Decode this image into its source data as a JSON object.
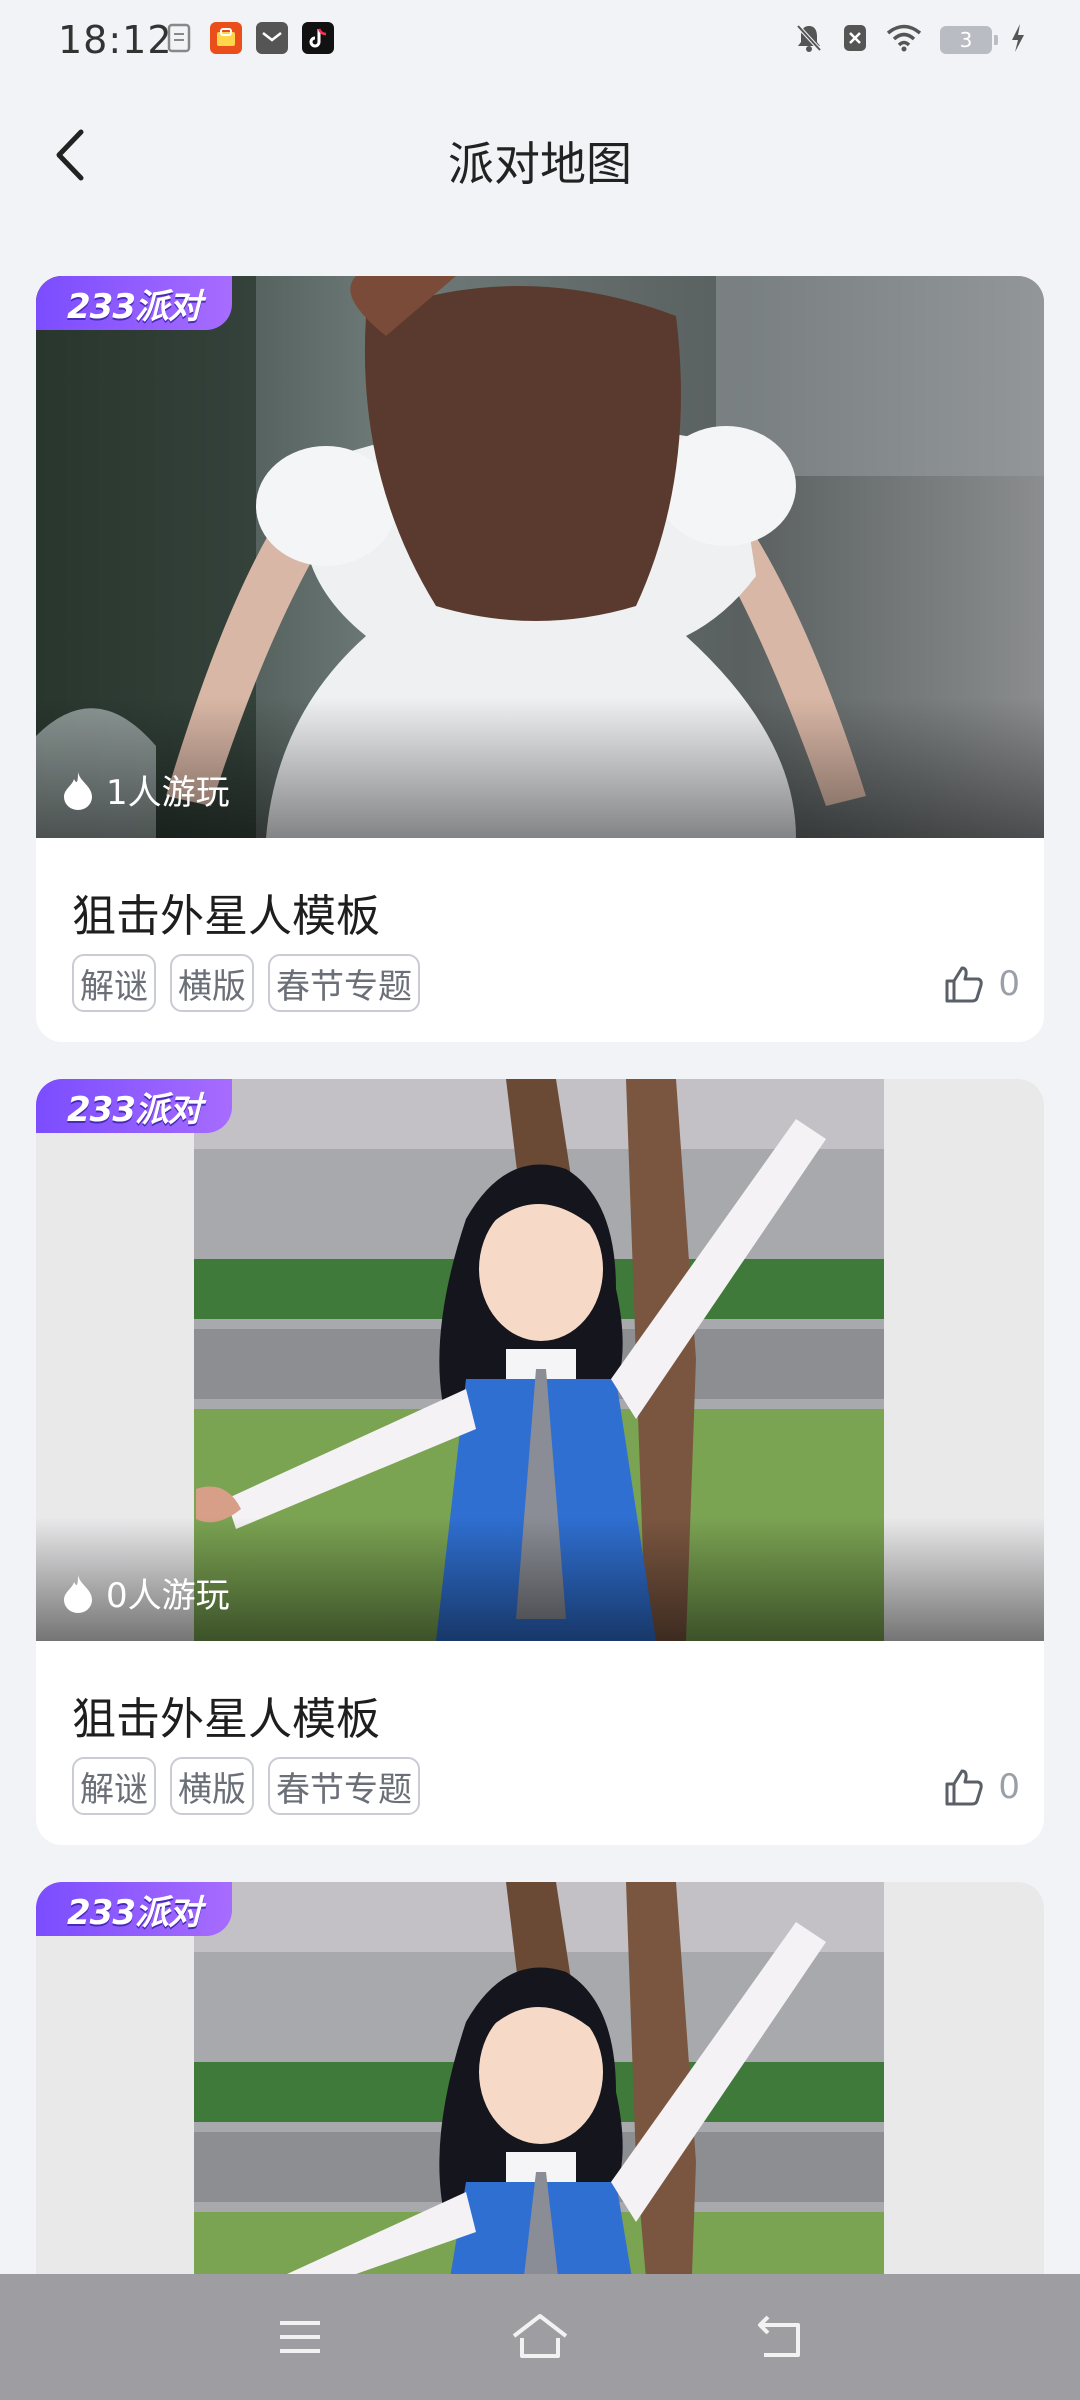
{
  "status_bar": {
    "time": "18:12",
    "battery": "3"
  },
  "header": {
    "title": "派对地图"
  },
  "cards": [
    {
      "badge": "233派对",
      "players": "1人游玩",
      "title": "狙击外星人模板",
      "tags": [
        "解谜",
        "横版",
        "春节专题"
      ],
      "likes": "0"
    },
    {
      "badge": "233派对",
      "players": "0人游玩",
      "title": "狙击外星人模板",
      "tags": [
        "解谜",
        "横版",
        "春节专题"
      ],
      "likes": "0"
    },
    {
      "badge": "233派对"
    }
  ],
  "icons": {
    "back": "chevron-left-icon",
    "players": "fire-icon",
    "likes": "thumbs-up-icon",
    "nav_menu": "menu-icon",
    "nav_home": "home-icon",
    "nav_back": "return-icon"
  },
  "colors": {
    "background": "#f1f3f6",
    "badge_purple": "#8a5cff",
    "nav_bar": "#9e9ea2"
  }
}
